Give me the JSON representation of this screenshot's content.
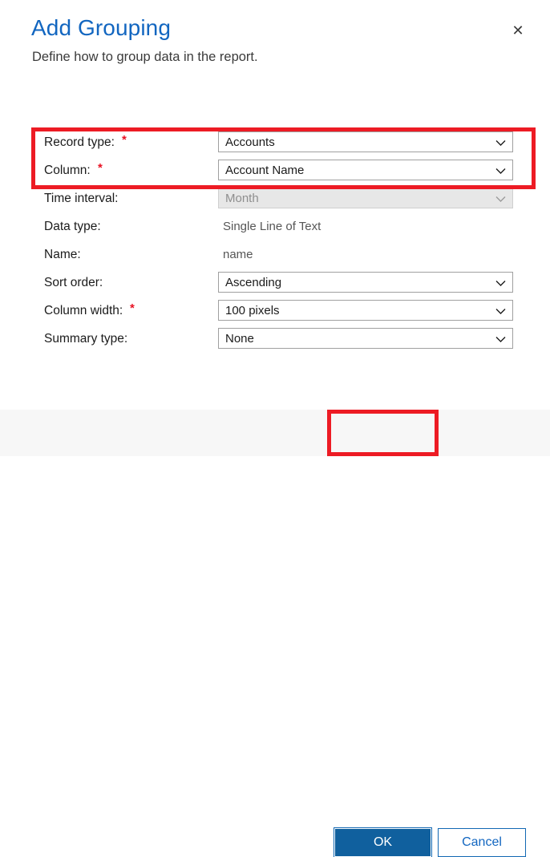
{
  "dialog": {
    "title": "Add Grouping",
    "subtitle": "Define how to group data in the report.",
    "close_icon": "close-icon",
    "accent_color": "#1266c0",
    "annotation_color": "#ed1b24",
    "footer_background": "#f7f7f7"
  },
  "form": {
    "required_marker": "*",
    "rows": [
      {
        "label": "Record type:",
        "required": true,
        "control": "dropdown",
        "value": "Accounts",
        "disabled": false,
        "highlighted": true
      },
      {
        "label": "Column:",
        "required": true,
        "control": "dropdown",
        "value": "Account Name",
        "disabled": false,
        "highlighted": true
      },
      {
        "label": "Time interval:",
        "required": false,
        "control": "dropdown",
        "value": "Month",
        "disabled": true,
        "highlighted": false
      },
      {
        "label": "Data type:",
        "required": false,
        "control": "static",
        "value": "Single Line of Text",
        "disabled": false,
        "highlighted": false
      },
      {
        "label": "Name:",
        "required": false,
        "control": "static",
        "value": "name",
        "disabled": false,
        "highlighted": false
      },
      {
        "label": "Sort order:",
        "required": false,
        "control": "dropdown",
        "value": "Ascending",
        "disabled": false,
        "highlighted": false
      },
      {
        "label": "Column width:",
        "required": true,
        "control": "dropdown",
        "value": "100 pixels",
        "disabled": false,
        "highlighted": false
      },
      {
        "label": "Summary type:",
        "required": false,
        "control": "dropdown",
        "value": "None",
        "disabled": false,
        "highlighted": false
      }
    ]
  },
  "footer": {
    "ok_label": "OK",
    "cancel_label": "Cancel",
    "ok_highlighted": true
  }
}
